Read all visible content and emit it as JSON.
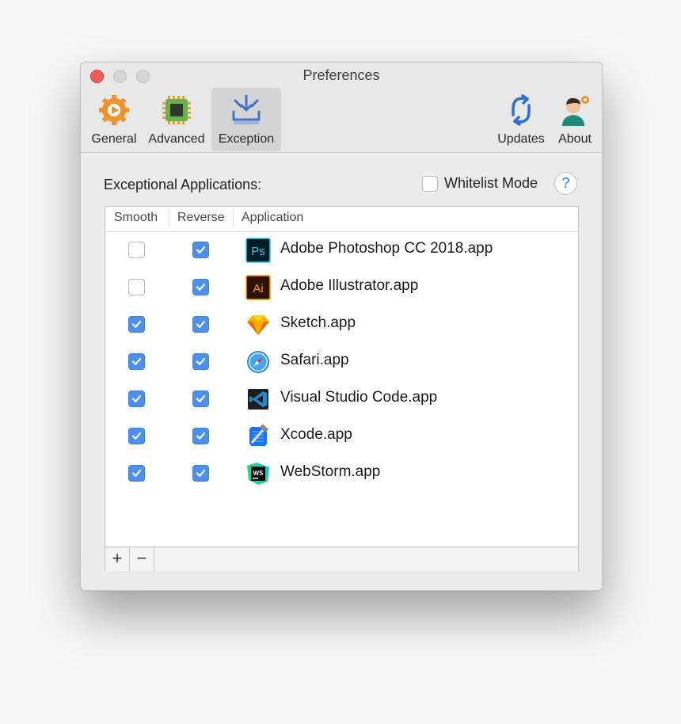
{
  "window": {
    "title": "Preferences"
  },
  "toolbar": {
    "items": [
      {
        "label": "General",
        "icon": "general-icon"
      },
      {
        "label": "Advanced",
        "icon": "advanced-icon"
      },
      {
        "label": "Exception",
        "icon": "exception-icon",
        "selected": true
      },
      {
        "label": "Updates",
        "icon": "updates-icon"
      },
      {
        "label": "About",
        "icon": "about-icon"
      }
    ]
  },
  "exceptions": {
    "section_label": "Exceptional Applications:",
    "whitelist_label": "Whitelist Mode",
    "whitelist_checked": false,
    "help_label": "?",
    "columns": [
      "Smooth",
      "Reverse",
      "Application"
    ],
    "rows": [
      {
        "smooth": false,
        "reverse": true,
        "app": "Adobe Photoshop CC 2018.app",
        "icon": "photoshop-icon"
      },
      {
        "smooth": false,
        "reverse": true,
        "app": "Adobe Illustrator.app",
        "icon": "illustrator-icon"
      },
      {
        "smooth": true,
        "reverse": true,
        "app": "Sketch.app",
        "icon": "sketch-icon"
      },
      {
        "smooth": true,
        "reverse": true,
        "app": "Safari.app",
        "icon": "safari-icon"
      },
      {
        "smooth": true,
        "reverse": true,
        "app": "Visual Studio Code.app",
        "icon": "vscode-icon"
      },
      {
        "smooth": true,
        "reverse": true,
        "app": "Xcode.app",
        "icon": "xcode-icon"
      },
      {
        "smooth": true,
        "reverse": true,
        "app": "WebStorm.app",
        "icon": "webstorm-icon"
      }
    ],
    "add_label": "+",
    "remove_label": "−"
  },
  "colors": {
    "accent": "#4a90ec",
    "close": "#ee5c55"
  }
}
